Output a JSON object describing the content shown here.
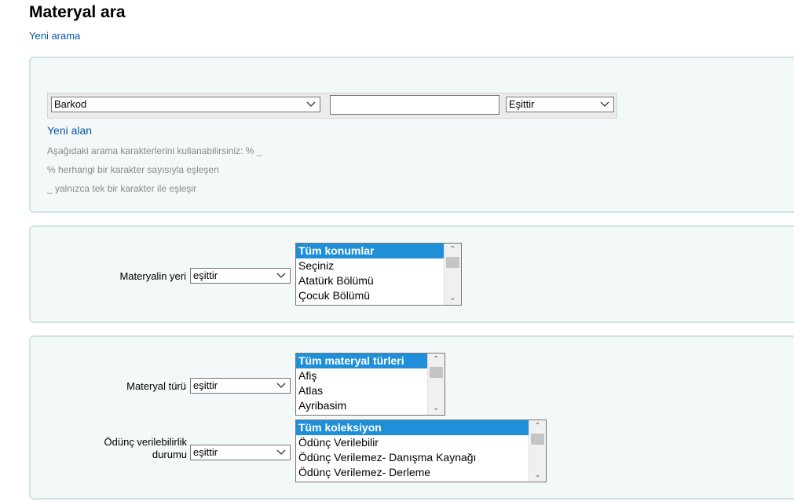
{
  "page": {
    "title": "Materyal ara",
    "new_search_link": "Yeni arama"
  },
  "search_fields": {
    "field_select": "Barkod",
    "value_input": "",
    "operator_select": "Eşittir",
    "new_field_link": "Yeni alan",
    "hints": [
      "Aşağıdaki arama karakterlerini kullanabilirsiniz: % _",
      "% herhangi bir karakter sayısıyla eşleşen",
      "_ yalnızca tek bir karakter ile eşleşir"
    ]
  },
  "location": {
    "label": "Materyalin yeri",
    "operator": "eşittir",
    "options": [
      "Tüm konumlar",
      "Seçiniz",
      "Atatürk Bölümü",
      "Çocuk Bölümü"
    ]
  },
  "item_type": {
    "label": "Materyal türü",
    "operator": "eşittir",
    "options": [
      "Tüm materyal türleri",
      "Afiş",
      "Atlas",
      "Ayribasim"
    ]
  },
  "loan_status": {
    "label_line1": "Ödünç verilebilirlik",
    "label_line2": "durumu",
    "operator": "eşittir",
    "options": [
      "Tüm koleksiyon",
      "Ödünç Verilebilir",
      "Ödünç Verilemez- Danışma Kaynağı",
      "Ödünç Verilemez- Derleme"
    ]
  },
  "colors": {
    "link": "#0b57a4",
    "panel_bg": "#f3f8f8",
    "panel_border": "#cfe5e3",
    "selected_option": "#1f8fda",
    "hint_text": "#8a8a8a"
  }
}
